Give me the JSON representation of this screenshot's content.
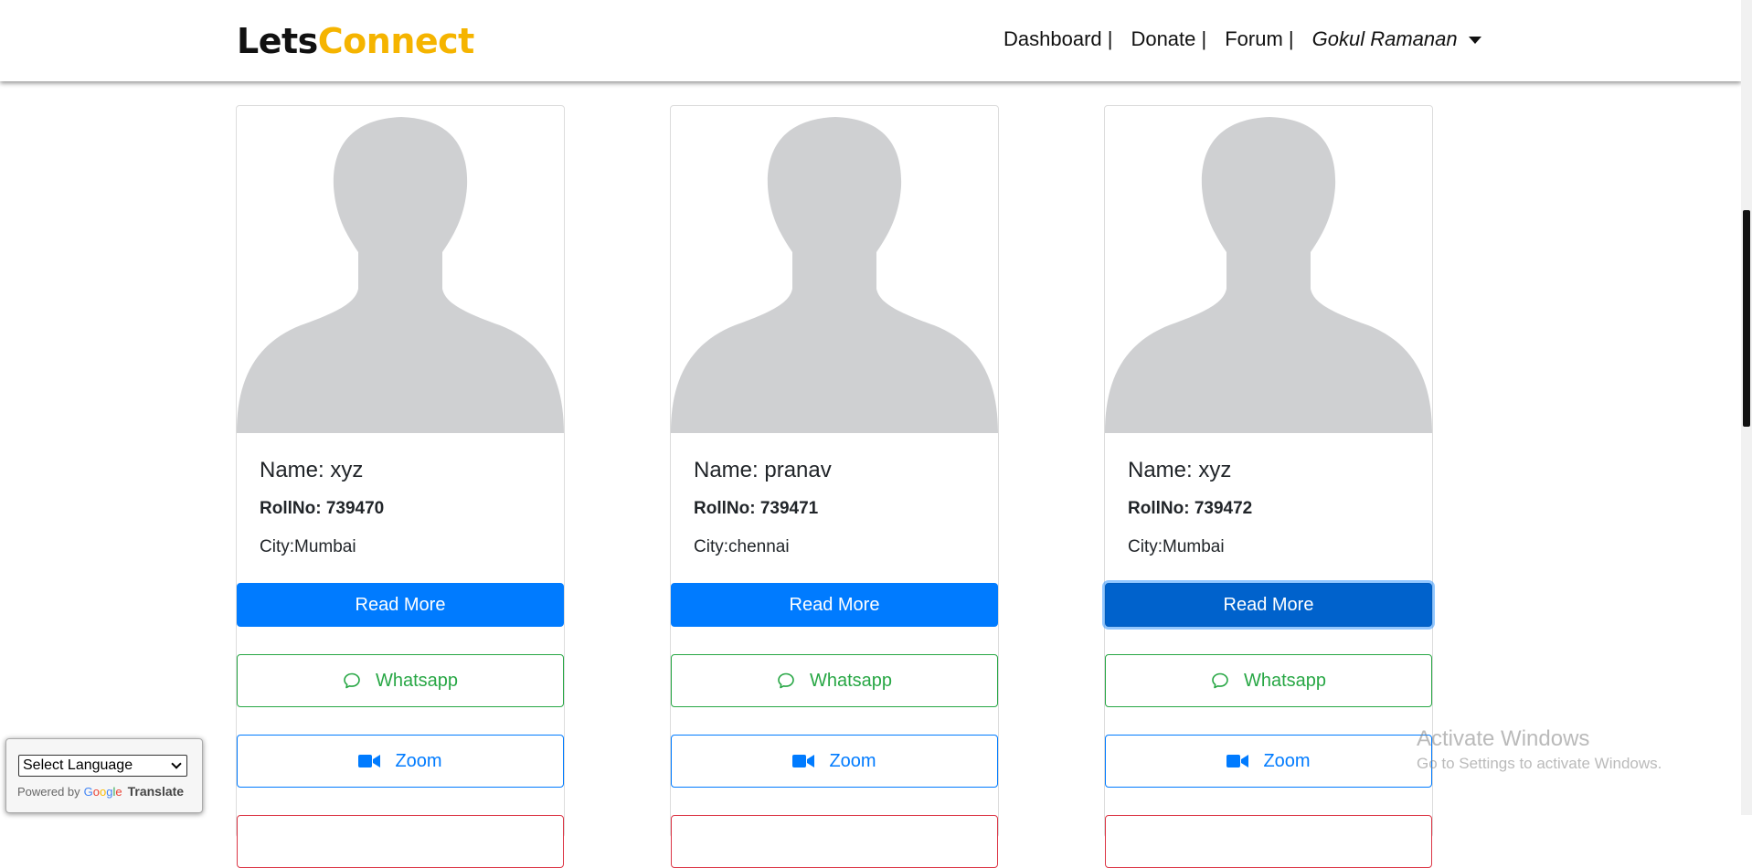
{
  "brand": {
    "part1": "Lets",
    "part2": "Connect"
  },
  "nav": {
    "dashboard": "Dashboard |",
    "donate": "Donate |",
    "forum": "Forum |",
    "user": "Gokul Ramanan"
  },
  "cards": [
    {
      "name": "Name: xyz",
      "roll": "RollNo: 739470",
      "city": "City:Mumbai",
      "read_more": "Read More",
      "whatsapp": "Whatsapp",
      "zoom": "Zoom"
    },
    {
      "name": "Name: pranav",
      "roll": "RollNo: 739471",
      "city": "City:chennai",
      "read_more": "Read More",
      "whatsapp": "Whatsapp",
      "zoom": "Zoom"
    },
    {
      "name": "Name: xyz",
      "roll": "RollNo: 739472",
      "city": "City:Mumbai",
      "read_more": "Read More",
      "whatsapp": "Whatsapp",
      "zoom": "Zoom"
    }
  ],
  "translate": {
    "select_label": "Select Language",
    "powered_by": "Powered by",
    "google": "Google",
    "translate": "Translate"
  },
  "watermark": {
    "title": "Activate Windows",
    "subtitle": "Go to Settings to activate Windows."
  },
  "colors": {
    "brand_dark": "#111111",
    "brand_accent": "#f5b400",
    "primary": "#007bff",
    "success": "#28a745",
    "danger": "#dc3545",
    "avatar_silhouette": "#cfd0d2"
  },
  "icons": {
    "whatsapp": "chat-bubble-icon",
    "zoom": "video-camera-icon",
    "user_menu": "caret-down-icon",
    "avatar": "user-silhouette-icon"
  }
}
